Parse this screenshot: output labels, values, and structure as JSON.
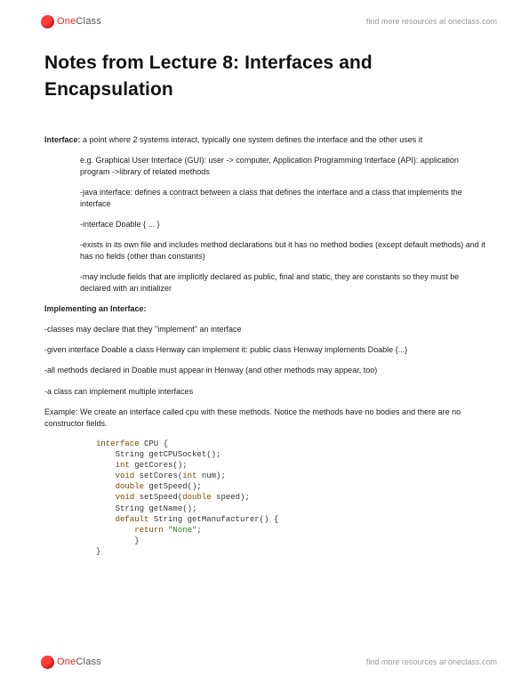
{
  "brand": {
    "one": "One",
    "class": "Class"
  },
  "header_link": "find more resources at oneclass.com",
  "footer_link": "find more resources at oneclass.com",
  "title": "Notes from Lecture 8: Interfaces and Encapsulation",
  "p_interface_label": "Interface:",
  "p_interface_body": " a point where 2 systems interact, typically one system defines the interface and the other uses it",
  "bul1": "e.g. Graphical User Interface (GUI): user -> computer, Application Programming Interface (API): application program ->library of related methods",
  "bul2": "-java interface: defines a contract between a class that defines the interface and a class that implements the interface",
  "bul3": "-interface Doable { ... }",
  "bul4": "-exists in its own file and includes method declarations but it has no method bodies (except default methods) and it has no fields (other than constants)",
  "bul5": "-may include fields that are implicitly declared as public, final and static, they are constants so they must be declared with an initializer",
  "impl_heading": "Implementing an Interface:",
  "impl1": "-classes may declare that they \"implement\" an interface",
  "impl2": "-given interface Doable a class Henway can implement it: public class Henway implements Doable {...}",
  "impl3": "-all methods declared in Doable must appear in Henway (and other methods may appear, too)",
  "impl4": "-a class can implement multiple interfaces",
  "example": "Example: We create an interface called cpu with these methods. Notice the methods have no bodies and there are no constructor fields.",
  "code": {
    "l1a": "interface",
    "l1b": " CPU {",
    "l2a": "    String getCPUSocket();",
    "l3a": "    int",
    "l3b": " getCores();",
    "l4a": "    void",
    "l4b": " setCores(",
    "l4c": "int",
    "l4d": " num);",
    "l5a": "    double",
    "l5b": " getSpeed();",
    "l6a": "    void",
    "l6b": " setSpeed(",
    "l6c": "double",
    "l6d": " speed);",
    "l7a": "    String getName();",
    "l8a": "    default",
    "l8b": " String getManufacturer() {",
    "l9a": "        return ",
    "l9b": "\"None\"",
    "l9c": ";",
    "l10": "        }",
    "l11": "}"
  }
}
